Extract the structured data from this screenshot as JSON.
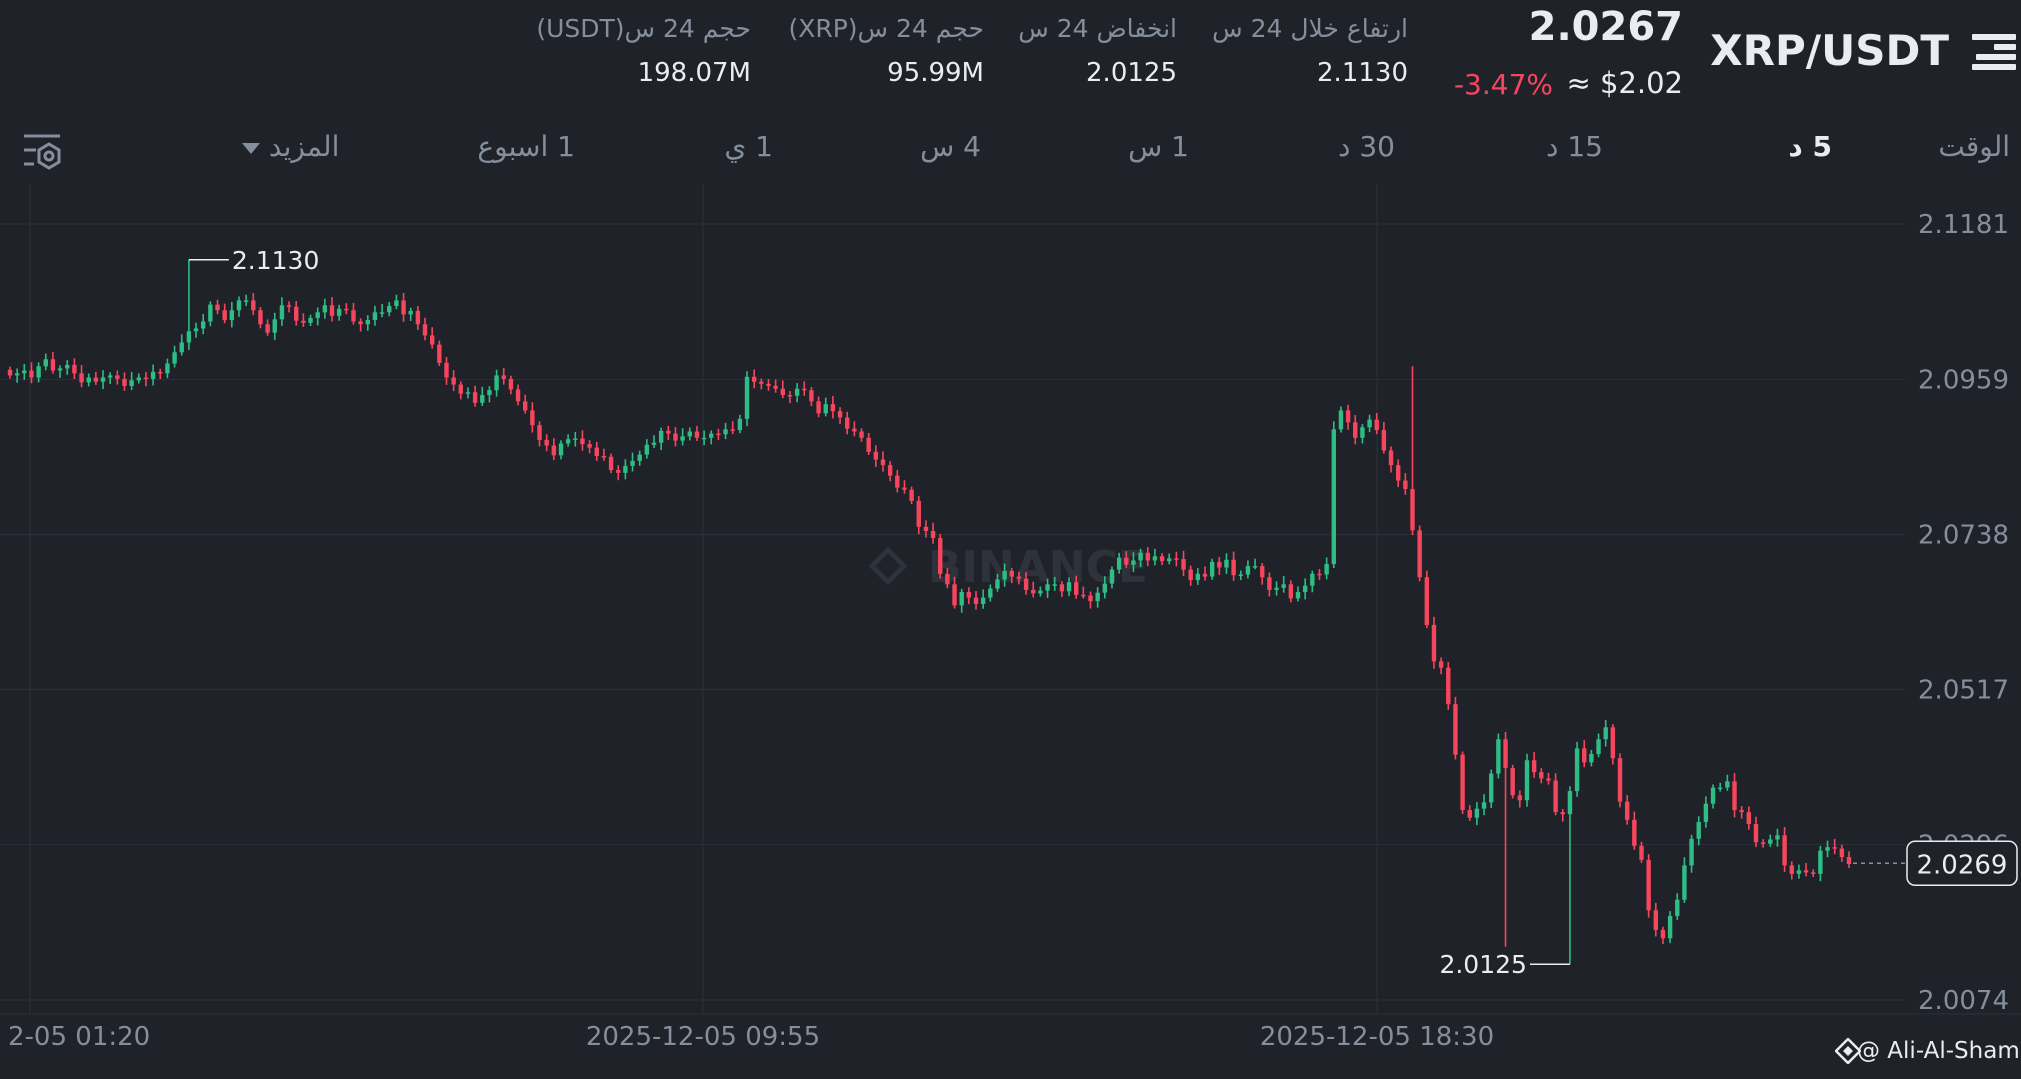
{
  "header": {
    "pair": "XRP/USDT",
    "last_price": "2.0267",
    "usd_price": "≈ $2.02",
    "change_pct": "-3.47%",
    "stats": [
      {
        "label": "ارتفاع خلال 24 س",
        "value": "2.1130"
      },
      {
        "label": "انخفاض 24 س",
        "value": "2.0125"
      },
      {
        "label": "حجم 24 س(XRP)",
        "value": "95.99M"
      },
      {
        "label": "حجم 24 س(USDT)",
        "value": "198.07M"
      }
    ]
  },
  "timeframes": {
    "label": "الوقت",
    "items": [
      "5 د",
      "15 د",
      "30 د",
      "1 س",
      "4 س",
      "1 ي",
      "1 اسبوع"
    ],
    "active": "5 د",
    "more": "المزيد"
  },
  "chart_data": {
    "type": "candlestick",
    "y_ticks": [
      "2.1181",
      "2.0959",
      "2.0738",
      "2.0517",
      "2.0296",
      "2.0074"
    ],
    "ylim": [
      2.0074,
      2.1181
    ],
    "x_ticks": [
      "2-05 01:20",
      "2025-12-05 09:55",
      "2025-12-05 18:30"
    ],
    "current_price_label": "2.0269",
    "high_marker": "2.1130",
    "low_marker": "2.0125",
    "watermark": "BINANCE",
    "candles_close": [
      2.0965,
      2.0968,
      2.0972,
      2.0962,
      2.0978,
      2.0988,
      2.0972,
      2.0975,
      2.098,
      2.0968,
      2.0955,
      2.0962,
      2.0956,
      2.0962,
      2.0965,
      2.096,
      2.095,
      2.0958,
      2.0962,
      2.096,
      2.097,
      2.0968,
      2.0982,
      2.0998,
      2.1012,
      2.1028,
      2.1032,
      2.1042,
      2.1066,
      2.1058,
      2.1044,
      2.1058,
      2.1072,
      2.1072,
      2.1058,
      2.1038,
      2.1026,
      2.1045,
      2.1065,
      2.1063,
      2.1043,
      2.104,
      2.1047,
      2.1055,
      2.1065,
      2.105,
      2.106,
      2.1058,
      2.1042,
      2.1038,
      2.1044,
      2.1055,
      2.1055,
      2.1064,
      2.1072,
      2.1052,
      2.1057,
      2.1038,
      2.1022,
      2.1009,
      2.0983,
      2.0962,
      2.0952,
      2.0939,
      2.0941,
      2.0926,
      2.0937,
      2.0944,
      2.0965,
      2.096,
      2.0945,
      2.0928,
      2.0915,
      2.0894,
      2.0873,
      2.0865,
      2.0851,
      2.0868,
      2.0874,
      2.0875,
      2.0867,
      2.0862,
      2.085,
      2.0849,
      2.083,
      2.0826,
      2.0836,
      2.0843,
      2.0852,
      2.0866,
      2.0869,
      2.0886,
      2.0882,
      2.0872,
      2.0878,
      2.0885,
      2.0876,
      2.0876,
      2.0882,
      2.0881,
      2.0888,
      2.0887,
      2.0903,
      2.0963,
      2.0956,
      2.0953,
      2.095,
      2.0946,
      2.0937,
      2.0936,
      2.0946,
      2.0944,
      2.0928,
      2.0911,
      2.0924,
      2.0914,
      2.0905,
      2.0889,
      2.0885,
      2.0876,
      2.0856,
      2.0845,
      2.0837,
      2.0822,
      2.0805,
      2.0802,
      2.0786,
      2.0749,
      2.0743,
      2.0733,
      2.0682,
      2.0667,
      2.0637,
      2.0656,
      2.0648,
      2.0639,
      2.0648,
      2.0661,
      2.0674,
      2.0686,
      2.0678,
      2.0675,
      2.0659,
      2.0654,
      2.0658,
      2.0667,
      2.0667,
      2.0657,
      2.067,
      2.0652,
      2.0651,
      2.0643,
      2.0655,
      2.0668,
      2.0688,
      2.0705,
      2.0695,
      2.0701,
      2.0712,
      2.0701,
      2.0707,
      2.07,
      2.0704,
      2.0703,
      2.0688,
      2.0673,
      2.0682,
      2.0678,
      2.0699,
      2.0691,
      2.0702,
      2.068,
      2.0681,
      2.0693,
      2.0693,
      2.0677,
      2.0659,
      2.0662,
      2.0667,
      2.0647,
      2.0656,
      2.0665,
      2.0682,
      2.0681,
      2.0696,
      2.0888,
      2.0915,
      2.0898,
      2.0876,
      2.0891,
      2.0902,
      2.0887,
      2.0858,
      2.0837,
      2.0815,
      2.0803,
      2.0744,
      2.0677,
      2.0609,
      2.0557,
      2.0548,
      2.0496,
      2.0424,
      2.0345,
      2.0334,
      2.0347,
      2.0356,
      2.0397,
      2.0446,
      2.0405,
      2.0366,
      2.0359,
      2.0416,
      2.0399,
      2.039,
      2.0387,
      2.0342,
      2.0339,
      2.0372,
      2.0433,
      2.0413,
      2.0425,
      2.0446,
      2.0463,
      2.0419,
      2.0357,
      2.0331,
      2.0294,
      2.0274,
      2.0202,
      2.0174,
      2.0162,
      2.0194,
      2.0217,
      2.0266,
      2.0304,
      2.0328,
      2.0354,
      2.0377,
      2.0377,
      2.0386,
      2.0345,
      2.0342,
      2.0325,
      2.0299,
      2.0297,
      2.0303,
      2.0309,
      2.0266,
      2.0254,
      2.0259,
      2.0256,
      2.0254,
      2.0287,
      2.0292,
      2.029,
      2.0278,
      2.0268
    ]
  }
}
